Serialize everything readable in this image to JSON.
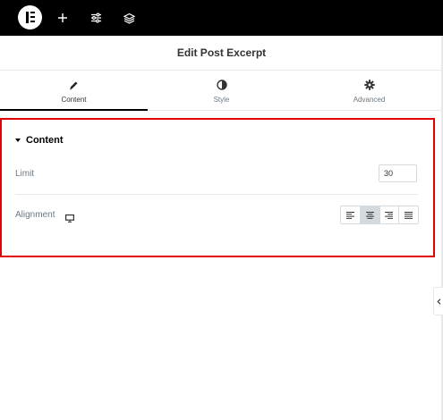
{
  "topbar": {
    "icons": [
      "elementor-logo-icon",
      "plus-icon",
      "sliders-icon",
      "layers-icon"
    ]
  },
  "header": {
    "title": "Edit Post Excerpt"
  },
  "tabs": [
    {
      "label": "Content",
      "icon": "pencil-icon",
      "active": true
    },
    {
      "label": "Style",
      "icon": "half-circle-icon",
      "active": false
    },
    {
      "label": "Advanced",
      "icon": "gear-icon",
      "active": false
    }
  ],
  "section": {
    "title": "Content",
    "limit": {
      "label": "Limit",
      "value": "30"
    },
    "alignment": {
      "label": "Alignment",
      "device_icon": "desktop-icon",
      "options": [
        "align-left",
        "align-center",
        "align-right",
        "align-justify"
      ],
      "selected": "align-center"
    }
  },
  "colors": {
    "highlight": "#e40000",
    "topbar": "#000000",
    "active_tab_underline": "#000000"
  }
}
